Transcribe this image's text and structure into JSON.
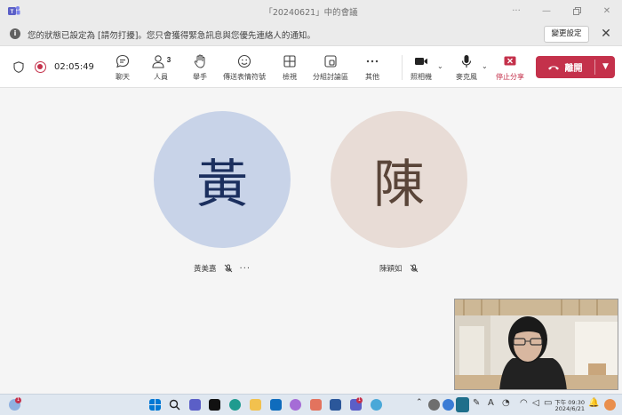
{
  "window": {
    "title": "「20240621」中的會議"
  },
  "banner": {
    "message": "您的狀態已設定為 [請勿打擾]。您只會獲得緊急訊息與您優先連絡人的通知。",
    "change_button": "變更設定"
  },
  "toolbar": {
    "timer": "02:05:49",
    "chat": "聊天",
    "people": "人員",
    "people_count": "3",
    "raise_hand": "舉手",
    "react": "傳送表情符號",
    "view": "檢視",
    "rooms": "分組討論區",
    "more": "其他",
    "camera": "照相機",
    "mic": "麥克風",
    "stop_share": "停止分享",
    "leave": "離開"
  },
  "participants": [
    {
      "initial": "黃",
      "name": "黃美嘉",
      "color": "#c8d3e8"
    },
    {
      "initial": "陳",
      "name": "陳穎如",
      "color": "#e8dcd6"
    }
  ],
  "taskbar": {
    "time_period": "下午 09:30",
    "date": "2024/6/21",
    "weather_badge": "1",
    "teams_badge": "1"
  },
  "colors": {
    "accent_red": "#c4314b",
    "toolbar_bg": "#ffffff",
    "stage_bg": "#f5f5f5"
  }
}
